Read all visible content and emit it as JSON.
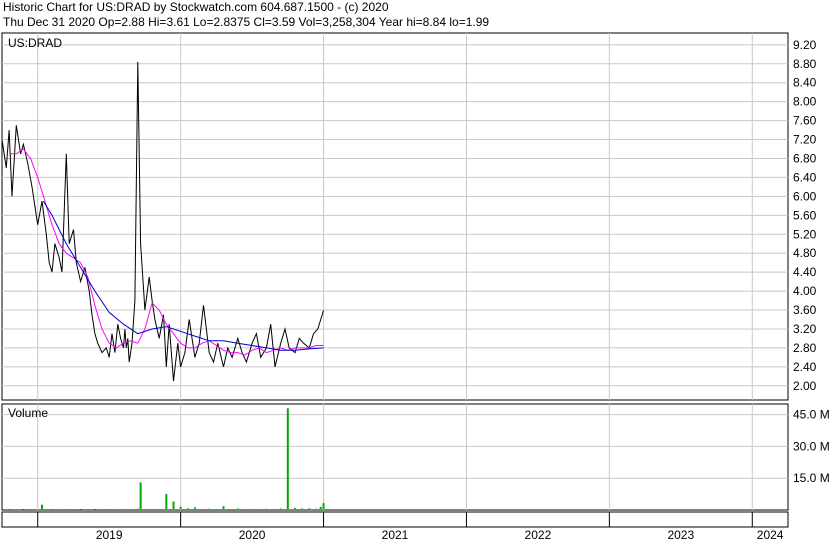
{
  "header": {
    "line1": "Historic Chart for US:DRAD by Stockwatch.com 604.687.1500 - (c) 2020",
    "line2": "Thu Dec 31 2020  Op=2.88  Hi=3.61  Lo=2.8375  Cl=3.59  Vol=3,258,304  Year hi=8.84  lo=1.99"
  },
  "colors": {
    "price": "#000000",
    "ma_short": "#ff00ff",
    "ma_long": "#0000cc",
    "volume": "#00aa00",
    "grid": "#c8c8c8"
  },
  "chart_data": [
    {
      "type": "line",
      "title": "US:DRAD",
      "y_ticks": [
        "9.20",
        "8.80",
        "8.40",
        "8.00",
        "7.60",
        "7.20",
        "6.80",
        "6.40",
        "6.00",
        "5.60",
        "5.20",
        "4.80",
        "4.40",
        "4.00",
        "3.60",
        "3.20",
        "2.80",
        "2.40",
        "2.00"
      ],
      "ylim": [
        1.7,
        9.45
      ],
      "x_ticks": [
        "2019",
        "2020",
        "2021",
        "2022",
        "2023",
        "2024"
      ],
      "xlim": [
        2018.75,
        2024.25
      ],
      "series": [
        {
          "name": "price",
          "x": [
            2018.75,
            2018.78,
            2018.8,
            2018.82,
            2018.85,
            2018.88,
            2018.9,
            2018.93,
            2018.96,
            2019.0,
            2019.03,
            2019.06,
            2019.08,
            2019.1,
            2019.12,
            2019.15,
            2019.17,
            2019.2,
            2019.22,
            2019.25,
            2019.27,
            2019.3,
            2019.33,
            2019.36,
            2019.38,
            2019.4,
            2019.42,
            2019.45,
            2019.48,
            2019.5,
            2019.52,
            2019.54,
            2019.56,
            2019.58,
            2019.6,
            2019.61,
            2019.62,
            2019.63,
            2019.64,
            2019.66,
            2019.68,
            2019.7,
            2019.72,
            2019.75,
            2019.78,
            2019.8,
            2019.82,
            2019.85,
            2019.88,
            2019.9,
            2019.92,
            2019.95,
            2019.98,
            2020.0,
            2020.03,
            2020.06,
            2020.1,
            2020.13,
            2020.16,
            2020.2,
            2020.23,
            2020.26,
            2020.3,
            2020.33,
            2020.36,
            2020.4,
            2020.43,
            2020.46,
            2020.5,
            2020.53,
            2020.56,
            2020.6,
            2020.63,
            2020.66,
            2020.7,
            2020.73,
            2020.76,
            2020.8,
            2020.83,
            2020.86,
            2020.9,
            2020.93,
            2020.96,
            2021.0
          ],
          "values": [
            7.2,
            6.6,
            7.4,
            6.0,
            7.5,
            6.9,
            7.1,
            6.7,
            6.2,
            5.4,
            5.9,
            5.2,
            4.6,
            4.4,
            5.0,
            4.7,
            4.4,
            6.9,
            5.0,
            5.3,
            4.6,
            4.2,
            4.5,
            4.0,
            3.5,
            3.1,
            2.9,
            2.7,
            2.8,
            2.6,
            3.1,
            2.7,
            3.3,
            3.0,
            2.8,
            3.2,
            2.8,
            3.0,
            2.5,
            2.9,
            3.8,
            8.84,
            5.0,
            3.6,
            4.3,
            3.8,
            3.4,
            3.0,
            3.5,
            2.4,
            3.3,
            2.1,
            2.9,
            2.4,
            2.7,
            3.4,
            2.6,
            2.9,
            3.7,
            2.7,
            2.5,
            2.9,
            2.4,
            2.8,
            2.6,
            3.0,
            2.7,
            2.5,
            2.9,
            3.1,
            2.6,
            2.8,
            3.3,
            2.4,
            2.9,
            3.2,
            2.8,
            2.7,
            3.0,
            2.9,
            2.8,
            3.1,
            3.2,
            3.59
          ]
        },
        {
          "name": "ma_short",
          "x": [
            2018.8,
            2018.85,
            2018.9,
            2018.95,
            2019.0,
            2019.05,
            2019.1,
            2019.15,
            2019.2,
            2019.25,
            2019.3,
            2019.35,
            2019.4,
            2019.45,
            2019.5,
            2019.55,
            2019.6,
            2019.65,
            2019.7,
            2019.75,
            2019.8,
            2019.85,
            2019.9,
            2019.95,
            2020.0,
            2020.05,
            2020.1,
            2020.15,
            2020.2,
            2020.25,
            2020.3,
            2020.35,
            2020.4,
            2020.45,
            2020.5,
            2020.55,
            2020.6,
            2020.65,
            2020.7,
            2020.75,
            2020.8,
            2020.85,
            2020.9,
            2020.95,
            2021.0
          ],
          "values": [
            6.9,
            6.9,
            7.0,
            6.8,
            6.4,
            5.9,
            5.4,
            5.0,
            4.8,
            4.7,
            4.6,
            4.3,
            3.7,
            3.2,
            2.9,
            2.8,
            2.9,
            2.95,
            2.9,
            3.2,
            3.75,
            3.6,
            3.3,
            3.1,
            2.9,
            2.8,
            2.8,
            2.9,
            2.95,
            2.85,
            2.75,
            2.7,
            2.7,
            2.65,
            2.75,
            2.8,
            2.7,
            2.75,
            2.8,
            2.75,
            2.8,
            2.8,
            2.8,
            2.85,
            2.85
          ]
        },
        {
          "name": "ma_long",
          "x": [
            2019.04,
            2019.1,
            2019.2,
            2019.3,
            2019.4,
            2019.5,
            2019.6,
            2019.7,
            2019.8,
            2019.9,
            2020.0,
            2020.1,
            2020.2,
            2020.3,
            2020.4,
            2020.5,
            2020.6,
            2020.7,
            2020.8,
            2020.9,
            2021.0
          ],
          "values": [
            5.9,
            5.6,
            5.0,
            4.5,
            4.0,
            3.55,
            3.3,
            3.1,
            3.2,
            3.25,
            3.15,
            3.05,
            2.95,
            2.95,
            2.9,
            2.85,
            2.8,
            2.75,
            2.75,
            2.78,
            2.8
          ]
        }
      ]
    },
    {
      "type": "bar",
      "title": "Volume",
      "y_ticks": [
        "45.0 M",
        "30.0 M",
        "15.0 M"
      ],
      "ylim": [
        0,
        50
      ],
      "xlim": [
        2018.75,
        2024.25
      ],
      "series": [
        {
          "name": "volume",
          "x": [
            2018.8,
            2018.9,
            2019.0,
            2019.03,
            2019.1,
            2019.2,
            2019.3,
            2019.4,
            2019.5,
            2019.6,
            2019.7,
            2019.72,
            2019.8,
            2019.9,
            2019.95,
            2020.0,
            2020.05,
            2020.1,
            2020.2,
            2020.3,
            2020.4,
            2020.5,
            2020.6,
            2020.65,
            2020.7,
            2020.75,
            2020.8,
            2020.85,
            2020.9,
            2020.95,
            2020.98,
            2021.0
          ],
          "values": [
            0.4,
            0.3,
            0.5,
            2.5,
            0.4,
            0.4,
            0.3,
            0.3,
            0.4,
            0.5,
            0.6,
            13.0,
            0.5,
            7.5,
            4.0,
            1.5,
            0.8,
            1.2,
            0.6,
            1.8,
            0.7,
            0.5,
            0.6,
            0.5,
            0.7,
            48.0,
            1.0,
            0.7,
            0.8,
            0.6,
            1.5,
            3.26
          ]
        }
      ]
    }
  ]
}
